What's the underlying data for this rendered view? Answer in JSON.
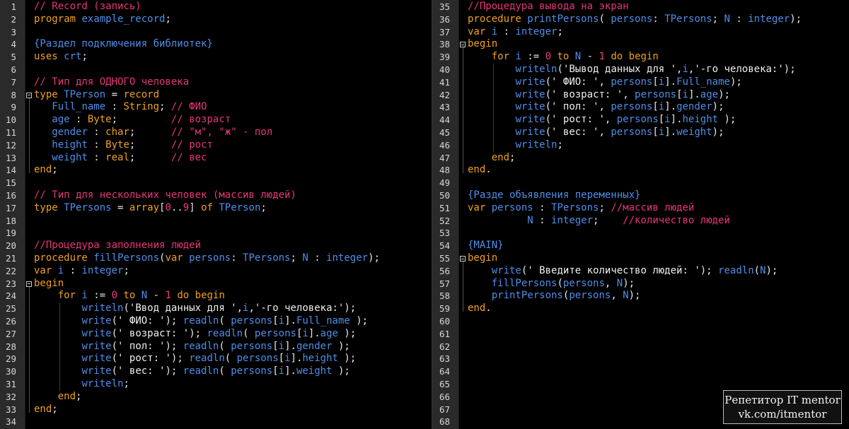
{
  "left": {
    "numbers": [
      "1",
      "2",
      "3",
      "4",
      "5",
      "6",
      "7",
      "8",
      "9",
      "10",
      "11",
      "12",
      "13",
      "14",
      "15",
      "16",
      "17",
      "18",
      "19",
      "20",
      "21",
      "22",
      "23",
      "24",
      "25",
      "26",
      "27",
      "28",
      "29",
      "30",
      "31",
      "32",
      "33",
      "34"
    ],
    "lines": [
      [
        [
          "cm",
          "// Record (запись)"
        ]
      ],
      [
        [
          "kw",
          "program "
        ],
        [
          "id",
          "example_record"
        ],
        [
          "op",
          ";"
        ]
      ],
      [],
      [
        [
          "id",
          "{Раздел подключения библиотек}"
        ]
      ],
      [
        [
          "kw",
          "uses "
        ],
        [
          "id",
          "crt"
        ],
        [
          "op",
          ";"
        ]
      ],
      [],
      [
        [
          "cm",
          "// Тип для ОДНОГО человека"
        ]
      ],
      [
        [
          "kw",
          "type "
        ],
        [
          "id",
          "TPerson"
        ],
        [
          "op",
          " = "
        ],
        [
          "kw",
          "record"
        ]
      ],
      [
        [
          "op",
          "   "
        ],
        [
          "id",
          "Full_name"
        ],
        [
          "op",
          " : "
        ],
        [
          "kw",
          "String"
        ],
        [
          "op",
          "; "
        ],
        [
          "cm",
          "// ФИО"
        ]
      ],
      [
        [
          "op",
          "   "
        ],
        [
          "id",
          "age"
        ],
        [
          "op",
          " : "
        ],
        [
          "kw",
          "Byte"
        ],
        [
          "op",
          ";         "
        ],
        [
          "cm",
          "// возраст"
        ]
      ],
      [
        [
          "op",
          "   "
        ],
        [
          "id",
          "gender"
        ],
        [
          "op",
          " : "
        ],
        [
          "kw",
          "char"
        ],
        [
          "op",
          ";      "
        ],
        [
          "cm",
          "// \"м\", \"ж\" - пол"
        ]
      ],
      [
        [
          "op",
          "   "
        ],
        [
          "id",
          "height"
        ],
        [
          "op",
          " : "
        ],
        [
          "kw",
          "Byte"
        ],
        [
          "op",
          ";      "
        ],
        [
          "cm",
          "// рост"
        ]
      ],
      [
        [
          "op",
          "   "
        ],
        [
          "id",
          "weight"
        ],
        [
          "op",
          " : "
        ],
        [
          "kw",
          "real"
        ],
        [
          "op",
          ";      "
        ],
        [
          "cm",
          "// вес"
        ]
      ],
      [
        [
          "kw",
          "end"
        ],
        [
          "op",
          ";"
        ]
      ],
      [],
      [
        [
          "cm",
          "// Тип для нескольких человек (массив людей)"
        ]
      ],
      [
        [
          "kw",
          "type "
        ],
        [
          "id",
          "TPersons"
        ],
        [
          "op",
          " = "
        ],
        [
          "kw",
          "array"
        ],
        [
          "op",
          "["
        ],
        [
          "nm",
          "0"
        ],
        [
          "op",
          ".."
        ],
        [
          "nm",
          "9"
        ],
        [
          "op",
          "] "
        ],
        [
          "kw",
          "of "
        ],
        [
          "id",
          "TPerson"
        ],
        [
          "op",
          ";"
        ]
      ],
      [],
      [],
      [
        [
          "cm",
          "//Процедура заполнения людей"
        ]
      ],
      [
        [
          "kw",
          "procedure "
        ],
        [
          "id",
          "fillPersons"
        ],
        [
          "op",
          "("
        ],
        [
          "kw",
          "var "
        ],
        [
          "id",
          "persons"
        ],
        [
          "op",
          ": "
        ],
        [
          "id",
          "TPersons"
        ],
        [
          "op",
          "; "
        ],
        [
          "id",
          "N"
        ],
        [
          "op",
          " : "
        ],
        [
          "id",
          "integer"
        ],
        [
          "op",
          ");"
        ]
      ],
      [
        [
          "kw",
          "var "
        ],
        [
          "id",
          "i"
        ],
        [
          "op",
          " : "
        ],
        [
          "id",
          "integer"
        ],
        [
          "op",
          ";"
        ]
      ],
      [
        [
          "kw",
          "begin"
        ]
      ],
      [
        [
          "op",
          "    "
        ],
        [
          "kw",
          "for "
        ],
        [
          "id",
          "i"
        ],
        [
          "op",
          " := "
        ],
        [
          "nm",
          "0"
        ],
        [
          "kw",
          " to "
        ],
        [
          "id",
          "N"
        ],
        [
          "op",
          " - "
        ],
        [
          "nm",
          "1"
        ],
        [
          "kw",
          " do begin"
        ]
      ],
      [
        [
          "op",
          "        "
        ],
        [
          "id",
          "writeln"
        ],
        [
          "op",
          "("
        ],
        [
          "st",
          "'Ввод данных для '"
        ],
        [
          "op",
          ","
        ],
        [
          "id",
          "i"
        ],
        [
          "op",
          ","
        ],
        [
          "st",
          "'-го человека:'"
        ],
        [
          "op",
          ");"
        ]
      ],
      [
        [
          "op",
          "        "
        ],
        [
          "id",
          "write"
        ],
        [
          "op",
          "("
        ],
        [
          "st",
          "' ФИО: '"
        ],
        [
          "op",
          "); "
        ],
        [
          "id",
          "readln"
        ],
        [
          "op",
          "( "
        ],
        [
          "id",
          "persons"
        ],
        [
          "op",
          "["
        ],
        [
          "id",
          "i"
        ],
        [
          "op",
          "]."
        ],
        [
          "id",
          "Full_name"
        ],
        [
          "op",
          " );"
        ]
      ],
      [
        [
          "op",
          "        "
        ],
        [
          "id",
          "write"
        ],
        [
          "op",
          "("
        ],
        [
          "st",
          "' возраст: '"
        ],
        [
          "op",
          "); "
        ],
        [
          "id",
          "readln"
        ],
        [
          "op",
          "( "
        ],
        [
          "id",
          "persons"
        ],
        [
          "op",
          "["
        ],
        [
          "id",
          "i"
        ],
        [
          "op",
          "]."
        ],
        [
          "id",
          "age"
        ],
        [
          "op",
          " );"
        ]
      ],
      [
        [
          "op",
          "        "
        ],
        [
          "id",
          "write"
        ],
        [
          "op",
          "("
        ],
        [
          "st",
          "' пол: '"
        ],
        [
          "op",
          "); "
        ],
        [
          "id",
          "readln"
        ],
        [
          "op",
          "( "
        ],
        [
          "id",
          "persons"
        ],
        [
          "op",
          "["
        ],
        [
          "id",
          "i"
        ],
        [
          "op",
          "]."
        ],
        [
          "id",
          "gender"
        ],
        [
          "op",
          " );"
        ]
      ],
      [
        [
          "op",
          "        "
        ],
        [
          "id",
          "write"
        ],
        [
          "op",
          "("
        ],
        [
          "st",
          "' рост: '"
        ],
        [
          "op",
          "); "
        ],
        [
          "id",
          "readln"
        ],
        [
          "op",
          "( "
        ],
        [
          "id",
          "persons"
        ],
        [
          "op",
          "["
        ],
        [
          "id",
          "i"
        ],
        [
          "op",
          "]."
        ],
        [
          "id",
          "height"
        ],
        [
          "op",
          " );"
        ]
      ],
      [
        [
          "op",
          "        "
        ],
        [
          "id",
          "write"
        ],
        [
          "op",
          "("
        ],
        [
          "st",
          "' вес: '"
        ],
        [
          "op",
          "); "
        ],
        [
          "id",
          "readln"
        ],
        [
          "op",
          "( "
        ],
        [
          "id",
          "persons"
        ],
        [
          "op",
          "["
        ],
        [
          "id",
          "i"
        ],
        [
          "op",
          "]."
        ],
        [
          "id",
          "weight"
        ],
        [
          "op",
          " );"
        ]
      ],
      [
        [
          "op",
          "        "
        ],
        [
          "id",
          "writeln"
        ],
        [
          "op",
          ";"
        ]
      ],
      [
        [
          "op",
          "    "
        ],
        [
          "kw",
          "end"
        ],
        [
          "op",
          ";"
        ]
      ],
      [
        [
          "kw",
          "end"
        ],
        [
          "op",
          ";"
        ]
      ],
      []
    ]
  },
  "right": {
    "numbers": [
      "35",
      "36",
      "37",
      "38",
      "39",
      "40",
      "41",
      "42",
      "43",
      "44",
      "45",
      "46",
      "47",
      "48",
      "49",
      "50",
      "51",
      "52",
      "53",
      "54",
      "55",
      "56",
      "57",
      "58",
      "59",
      "60",
      "61",
      "62",
      "63",
      "64",
      "65",
      "66",
      "67",
      "68"
    ],
    "lines": [
      [
        [
          "cm",
          "//Процедура вывода на экран"
        ]
      ],
      [
        [
          "kw",
          "procedure "
        ],
        [
          "id",
          "printPersons"
        ],
        [
          "op",
          "( "
        ],
        [
          "id",
          "persons"
        ],
        [
          "op",
          ": "
        ],
        [
          "id",
          "TPersons"
        ],
        [
          "op",
          "; "
        ],
        [
          "id",
          "N"
        ],
        [
          "op",
          " : "
        ],
        [
          "id",
          "integer"
        ],
        [
          "op",
          ");"
        ]
      ],
      [
        [
          "kw",
          "var "
        ],
        [
          "id",
          "i"
        ],
        [
          "op",
          " : "
        ],
        [
          "id",
          "integer"
        ],
        [
          "op",
          ";"
        ]
      ],
      [
        [
          "kw",
          "begin"
        ]
      ],
      [
        [
          "op",
          "    "
        ],
        [
          "kw",
          "for "
        ],
        [
          "id",
          "i"
        ],
        [
          "op",
          " := "
        ],
        [
          "nm",
          "0"
        ],
        [
          "kw",
          " to "
        ],
        [
          "id",
          "N"
        ],
        [
          "op",
          " - "
        ],
        [
          "nm",
          "1"
        ],
        [
          "kw",
          " do begin"
        ]
      ],
      [
        [
          "op",
          "        "
        ],
        [
          "id",
          "writeln"
        ],
        [
          "op",
          "("
        ],
        [
          "st",
          "'Вывод данных для '"
        ],
        [
          "op",
          ","
        ],
        [
          "id",
          "i"
        ],
        [
          "op",
          ","
        ],
        [
          "st",
          "'-го человека:'"
        ],
        [
          "op",
          ");"
        ]
      ],
      [
        [
          "op",
          "        "
        ],
        [
          "id",
          "write"
        ],
        [
          "op",
          "("
        ],
        [
          "st",
          "' ФИО: '"
        ],
        [
          "op",
          ", "
        ],
        [
          "id",
          "persons"
        ],
        [
          "op",
          "["
        ],
        [
          "id",
          "i"
        ],
        [
          "op",
          "]."
        ],
        [
          "id",
          "Full_name"
        ],
        [
          "op",
          ");"
        ]
      ],
      [
        [
          "op",
          "        "
        ],
        [
          "id",
          "write"
        ],
        [
          "op",
          "("
        ],
        [
          "st",
          "' возраст: '"
        ],
        [
          "op",
          ", "
        ],
        [
          "id",
          "persons"
        ],
        [
          "op",
          "["
        ],
        [
          "id",
          "i"
        ],
        [
          "op",
          "]."
        ],
        [
          "id",
          "age"
        ],
        [
          "op",
          ");"
        ]
      ],
      [
        [
          "op",
          "        "
        ],
        [
          "id",
          "write"
        ],
        [
          "op",
          "("
        ],
        [
          "st",
          "' пол: '"
        ],
        [
          "op",
          ", "
        ],
        [
          "id",
          "persons"
        ],
        [
          "op",
          "["
        ],
        [
          "id",
          "i"
        ],
        [
          "op",
          "]."
        ],
        [
          "id",
          "gender"
        ],
        [
          "op",
          ");"
        ]
      ],
      [
        [
          "op",
          "        "
        ],
        [
          "id",
          "write"
        ],
        [
          "op",
          "("
        ],
        [
          "st",
          "' рост: '"
        ],
        [
          "op",
          ", "
        ],
        [
          "id",
          "persons"
        ],
        [
          "op",
          "["
        ],
        [
          "id",
          "i"
        ],
        [
          "op",
          "]."
        ],
        [
          "id",
          "height"
        ],
        [
          "op",
          " );"
        ]
      ],
      [
        [
          "op",
          "        "
        ],
        [
          "id",
          "write"
        ],
        [
          "op",
          "("
        ],
        [
          "st",
          "' вес: '"
        ],
        [
          "op",
          ", "
        ],
        [
          "id",
          "persons"
        ],
        [
          "op",
          "["
        ],
        [
          "id",
          "i"
        ],
        [
          "op",
          "]."
        ],
        [
          "id",
          "weight"
        ],
        [
          "op",
          ");"
        ]
      ],
      [
        [
          "op",
          "        "
        ],
        [
          "id",
          "writeln"
        ],
        [
          "op",
          ";"
        ]
      ],
      [
        [
          "op",
          "    "
        ],
        [
          "kw",
          "end"
        ],
        [
          "op",
          ";"
        ]
      ],
      [
        [
          "kw",
          "end"
        ],
        [
          "op",
          "."
        ]
      ],
      [],
      [
        [
          "id",
          "{Разде объявления переменных}"
        ]
      ],
      [
        [
          "kw",
          "var "
        ],
        [
          "id",
          "persons"
        ],
        [
          "op",
          " : "
        ],
        [
          "id",
          "TPersons"
        ],
        [
          "op",
          "; "
        ],
        [
          "cm",
          "//массив людей"
        ]
      ],
      [
        [
          "op",
          "          "
        ],
        [
          "id",
          "N"
        ],
        [
          "op",
          " : "
        ],
        [
          "id",
          "integer"
        ],
        [
          "op",
          ";    "
        ],
        [
          "cm",
          "//количество людей"
        ]
      ],
      [],
      [
        [
          "id",
          "{MAIN}"
        ]
      ],
      [
        [
          "kw",
          "begin"
        ]
      ],
      [
        [
          "op",
          "    "
        ],
        [
          "id",
          "write"
        ],
        [
          "op",
          "("
        ],
        [
          "st",
          "' Введите количество людей: '"
        ],
        [
          "op",
          "); "
        ],
        [
          "id",
          "readln"
        ],
        [
          "op",
          "("
        ],
        [
          "id",
          "N"
        ],
        [
          "op",
          ");"
        ]
      ],
      [
        [
          "op",
          "    "
        ],
        [
          "id",
          "fillPersons"
        ],
        [
          "op",
          "("
        ],
        [
          "id",
          "persons"
        ],
        [
          "op",
          ", "
        ],
        [
          "id",
          "N"
        ],
        [
          "op",
          ");"
        ]
      ],
      [
        [
          "op",
          "    "
        ],
        [
          "id",
          "printPersons"
        ],
        [
          "op",
          "("
        ],
        [
          "id",
          "persons"
        ],
        [
          "op",
          ", "
        ],
        [
          "id",
          "N"
        ],
        [
          "op",
          ");"
        ]
      ],
      [
        [
          "kw",
          "end"
        ],
        [
          "op",
          "."
        ]
      ],
      [],
      [],
      [],
      [],
      [],
      [],
      [],
      [],
      []
    ]
  },
  "watermark": {
    "line1": "Репетитор IT mentor",
    "line2": "vk.com/itmentor"
  },
  "colors": {
    "keyword": "#f0a020",
    "identifier": "#4f8ee8",
    "comment": "#e8367a",
    "string": "#f0f0f0",
    "number": "#f23c7c"
  }
}
